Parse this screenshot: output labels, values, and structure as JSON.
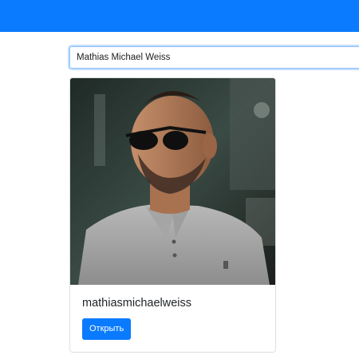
{
  "header": {
    "background_color": "#0a7bfe"
  },
  "search": {
    "value": "Mathias Michael Weiss",
    "focus_color": "#8fc1ff"
  },
  "results": [
    {
      "photo_icon": "profile-photo",
      "username": "mathiasmichaelweiss",
      "open_label": "Открыть"
    }
  ],
  "colors": {
    "accent": "#0a7bfe"
  }
}
